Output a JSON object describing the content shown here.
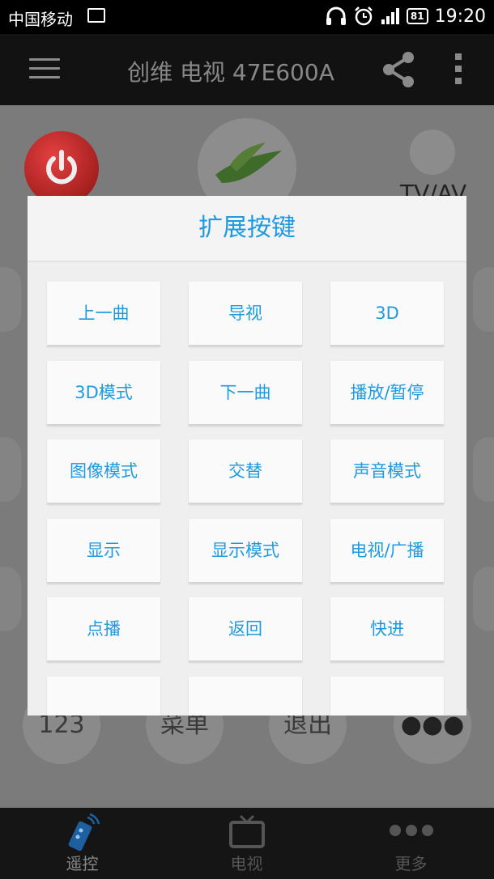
{
  "status_bar": {
    "carrier": "中国移动",
    "battery": "81",
    "time": "19:20",
    "icons": [
      "image-icon",
      "headphones-icon",
      "alarm-icon",
      "signal-icon",
      "battery-icon"
    ]
  },
  "header": {
    "title": "创维 电视 47E600A",
    "icons": [
      "menu-icon",
      "share-icon",
      "more-icon"
    ]
  },
  "remote": {
    "tvav_label": "TV/AV",
    "bottom_buttons": [
      "123",
      "菜单",
      "退出",
      "●●●"
    ]
  },
  "dialog": {
    "title": "扩展按键",
    "keys": [
      "上一曲",
      "导视",
      "3D",
      "3D模式",
      "下一曲",
      "播放/暂停",
      "图像模式",
      "交替",
      "声音模式",
      "显示",
      "显示模式",
      "电视/广播",
      "点播",
      "返回",
      "快进",
      "",
      "",
      ""
    ]
  },
  "tabs": [
    {
      "label": "遥控",
      "icon": "remote-icon",
      "active": true
    },
    {
      "label": "电视",
      "icon": "tv-icon",
      "active": false
    },
    {
      "label": "更多",
      "icon": "more-dots-icon",
      "active": false
    }
  ],
  "colors": {
    "accent": "#1e9ae0",
    "power": "#d42a2a"
  }
}
